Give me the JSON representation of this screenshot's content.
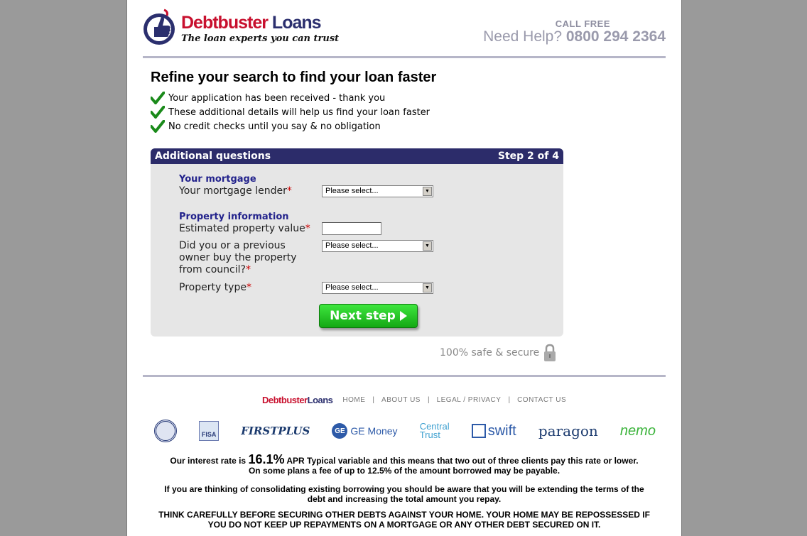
{
  "brand": {
    "name_part1": "Debtbuster",
    "name_part2": "Loans",
    "tagline": "The loan experts you can trust"
  },
  "header": {
    "call_free": "CALL FREE",
    "need_help": "Need Help?",
    "phone": "0800 294 2364"
  },
  "intro": {
    "title": "Refine your search to find your loan faster",
    "checks": [
      "Your application has been received - thank you",
      "These additional details will help us find your loan faster",
      "No credit checks until you say & no obligation"
    ]
  },
  "form": {
    "header_left": "Additional questions",
    "header_right": "Step 2 of 4",
    "section_mortgage": "Your mortgage",
    "lender_label": "Your mortgage lender",
    "lender_value": "Please select...",
    "section_property": "Property information",
    "value_label": "Estimated property value",
    "value_input": "",
    "council_label": "Did you or a previous owner buy the property from council?",
    "council_value": "Please select...",
    "type_label": "Property type",
    "type_value": "Please select...",
    "required_mark": "*",
    "next_label": "Next step"
  },
  "secure_text": "100% safe & secure",
  "footer": {
    "nav": [
      "HOME",
      "ABOUT US",
      "LEGAL / PRIVACY",
      "CONTACT US"
    ],
    "lenders": {
      "fisa": "FISA",
      "firstplus": "FIRSTPLUS",
      "ge_mark": "GE",
      "ge": "GE Money",
      "central1": "Central",
      "central2": "Trust",
      "swift": "swift",
      "paragon": "paragon",
      "nemo": "nemo"
    },
    "rate_prefix": "Our interest rate is",
    "rate_value": "16.1%",
    "rate_suffix": "APR Typical variable and this means that two out of three clients pay this rate or lower.",
    "rate_line2": "On some plans a fee of up to 12.5% of the amount borrowed may be payable.",
    "consolidate": "If you are thinking of consolidating existing borrowing you should be aware that you will be extending the terms of the debt and increasing the total amount you repay.",
    "warning": "THINK CAREFULLY BEFORE SECURING OTHER DEBTS AGAINST YOUR HOME. YOUR HOME MAY BE REPOSSESSED IF YOU DO NOT KEEP UP REPAYMENTS ON A MORTGAGE OR ANY OTHER DEBT SECURED ON IT."
  },
  "colors": {
    "brand_red": "#c8102e",
    "brand_navy": "#2b2f6e",
    "panel_header": "#2c2c6a",
    "button_green": "#22c022"
  }
}
